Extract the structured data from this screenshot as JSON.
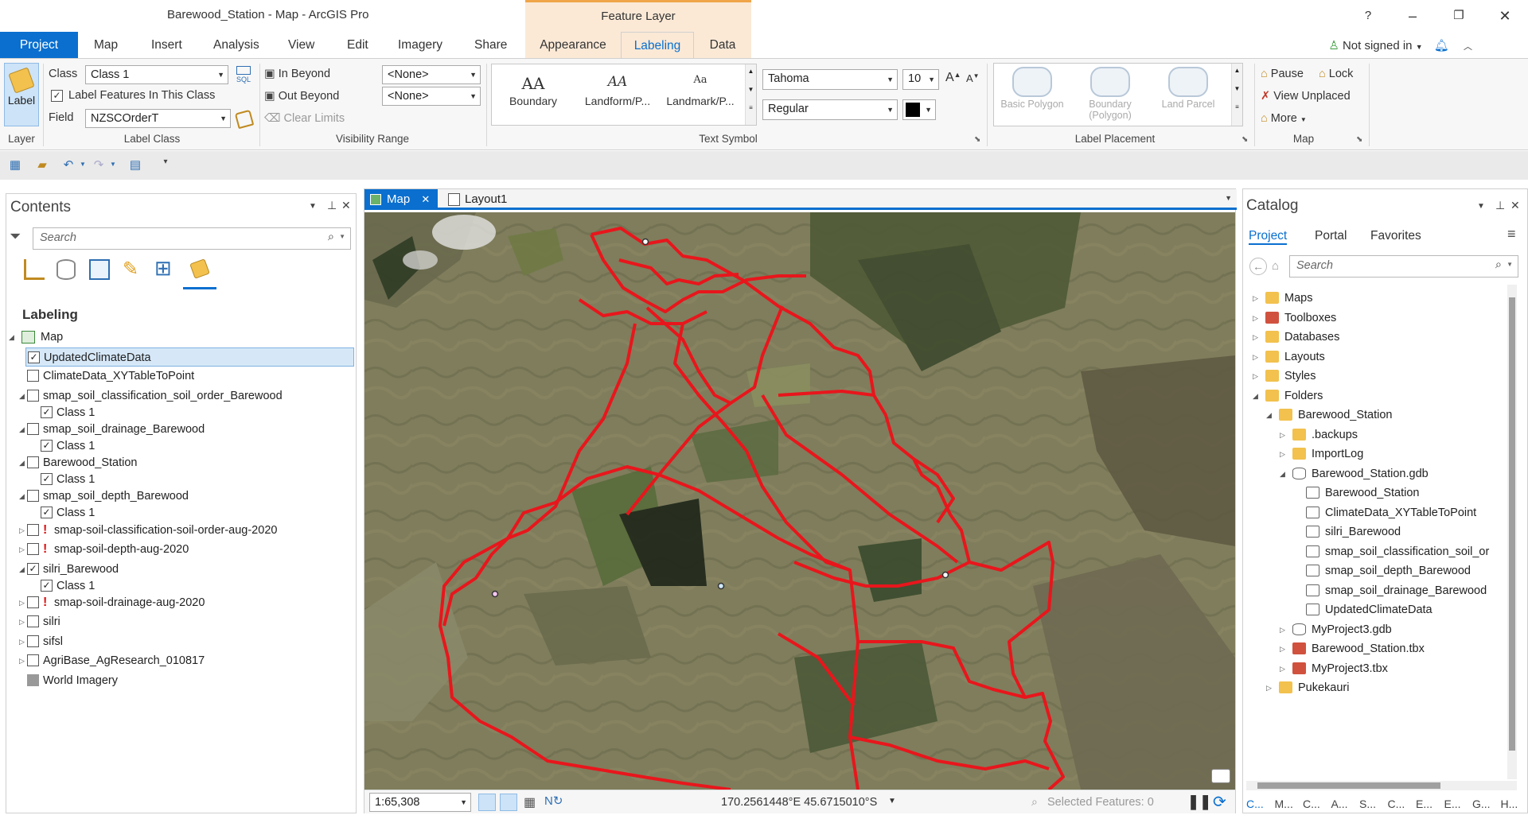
{
  "window": {
    "title": "Barewood_Station - Map - ArcGIS Pro",
    "context_tab_group": "Feature Layer",
    "help": "?",
    "minimize": "–",
    "restore": "❐",
    "close": "✕"
  },
  "ribbon_tabs": {
    "project": "Project",
    "map": "Map",
    "insert": "Insert",
    "analysis": "Analysis",
    "view": "View",
    "edit": "Edit",
    "imagery": "Imagery",
    "share": "Share",
    "appearance": "Appearance",
    "labeling": "Labeling",
    "data": "Data"
  },
  "account": {
    "signin": "Not signed in"
  },
  "ribbon": {
    "layer": {
      "label_button": "Label",
      "group": "Layer"
    },
    "label_class": {
      "class_label": "Class",
      "class_value": "Class 1",
      "sql": "SQL",
      "label_features_checkbox": "Label Features In This Class",
      "field_label": "Field",
      "field_value": "NZSCOrderT",
      "group": "Label Class"
    },
    "visibility_range": {
      "in_beyond": "In Beyond",
      "out_beyond": "Out Beyond",
      "clear_limits": "Clear Limits",
      "in_value": "<None>",
      "out_value": "<None>",
      "group": "Visibility Range"
    },
    "text_symbol": {
      "items": [
        {
          "glyph": "AA",
          "label": "Boundary"
        },
        {
          "glyph": "AA",
          "label": "Landform/P..."
        },
        {
          "glyph": "Aa",
          "label": "Landmark/P..."
        }
      ],
      "font": "Tahoma",
      "size": "10",
      "style": "Regular",
      "grow": "A",
      "shrink": "A",
      "group": "Text Symbol"
    },
    "label_placement": {
      "items": [
        {
          "label": "Basic Polygon"
        },
        {
          "label": "Boundary (Polygon)"
        },
        {
          "label": "Land Parcel"
        }
      ],
      "group": "Label Placement"
    },
    "map_group": {
      "pause": "Pause",
      "lock": "Lock",
      "view_unplaced": "View Unplaced",
      "more": "More",
      "group": "Map"
    }
  },
  "contents": {
    "title": "Contents",
    "search_placeholder": "Search",
    "section": "Labeling",
    "map_node": "Map",
    "layers": [
      {
        "name": "UpdatedClimateData",
        "checked": true
      },
      {
        "name": "ClimateData_XYTableToPoint",
        "checked": false
      },
      {
        "name": "smap_soil_classification_soil_order_Barewood",
        "checked": false
      },
      {
        "name": "Class 1",
        "checked": true
      },
      {
        "name": "smap_soil_drainage_Barewood",
        "checked": false
      },
      {
        "name": "Class 1",
        "checked": true
      },
      {
        "name": "Barewood_Station",
        "checked": false
      },
      {
        "name": "Class 1",
        "checked": true
      },
      {
        "name": "smap_soil_depth_Barewood",
        "checked": false
      },
      {
        "name": "Class 1",
        "checked": true
      },
      {
        "name": "smap-soil-classification-soil-order-aug-2020",
        "checked": false
      },
      {
        "name": "smap-soil-depth-aug-2020",
        "checked": false
      },
      {
        "name": "silri_Barewood",
        "checked": true
      },
      {
        "name": "Class 1",
        "checked": true
      },
      {
        "name": "smap-soil-drainage-aug-2020",
        "checked": false
      },
      {
        "name": "silri",
        "checked": false
      },
      {
        "name": "sifsl",
        "checked": false
      },
      {
        "name": "AgriBase_AgResearch_010817",
        "checked": false
      },
      {
        "name": "World Imagery",
        "checked": false
      }
    ]
  },
  "map_view": {
    "tabs": [
      "Map",
      "Layout1"
    ],
    "scale": "1:65,308",
    "coordinates": "170.2561448°E 45.6715010°S",
    "selected_features": "Selected Features: 0"
  },
  "catalog": {
    "title": "Catalog",
    "tabs": [
      "Project",
      "Portal",
      "Favorites"
    ],
    "search_placeholder": "Search",
    "items": [
      {
        "name": "Maps",
        "icon": "folder"
      },
      {
        "name": "Toolboxes",
        "icon": "toolbox"
      },
      {
        "name": "Databases",
        "icon": "folder"
      },
      {
        "name": "Layouts",
        "icon": "folder"
      },
      {
        "name": "Styles",
        "icon": "folder"
      },
      {
        "name": "Folders",
        "icon": "folder"
      },
      {
        "name": "Barewood_Station",
        "icon": "folder"
      },
      {
        "name": ".backups",
        "icon": "folder"
      },
      {
        "name": "ImportLog",
        "icon": "folder"
      },
      {
        "name": "Barewood_Station.gdb",
        "icon": "database"
      },
      {
        "name": "Barewood_Station",
        "icon": "feature-class"
      },
      {
        "name": "ClimateData_XYTableToPoint",
        "icon": "feature-class"
      },
      {
        "name": "silri_Barewood",
        "icon": "feature-class"
      },
      {
        "name": "smap_soil_classification_soil_or",
        "icon": "feature-class"
      },
      {
        "name": "smap_soil_depth_Barewood",
        "icon": "feature-class"
      },
      {
        "name": "smap_soil_drainage_Barewood",
        "icon": "feature-class"
      },
      {
        "name": "UpdatedClimateData",
        "icon": "feature-class"
      },
      {
        "name": "MyProject3.gdb",
        "icon": "database"
      },
      {
        "name": "Barewood_Station.tbx",
        "icon": "toolbox"
      },
      {
        "name": "MyProject3.tbx",
        "icon": "toolbox"
      },
      {
        "name": "Pukekauri",
        "icon": "folder"
      }
    ],
    "bottom_tabs": [
      "C...",
      "M...",
      "C...",
      "A...",
      "S...",
      "C...",
      "E...",
      "E...",
      "G...",
      "H..."
    ]
  },
  "colors": {
    "accent": "#0a6fcf",
    "boundary": "#e8161c",
    "context": "#fbe9d6"
  }
}
